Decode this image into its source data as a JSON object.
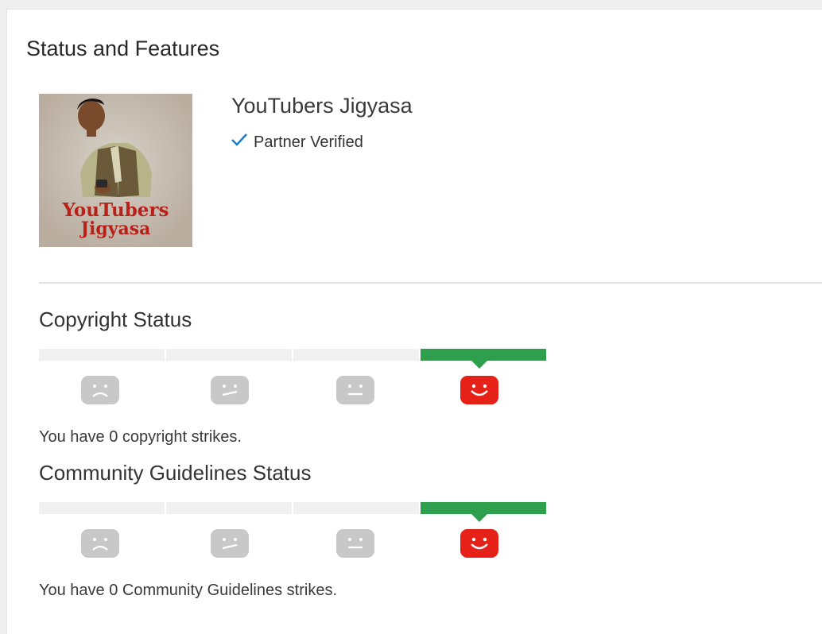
{
  "page": {
    "title": "Status and Features"
  },
  "channel": {
    "name": "YouTubers Jigyasa",
    "verified_label": "Partner Verified",
    "avatar_text_line1": "YouTubers",
    "avatar_text_line2": "Jigyasa"
  },
  "copyright": {
    "title": "Copyright Status",
    "strikes": 0,
    "message": "You have 0 copyright strikes."
  },
  "community": {
    "title": "Community Guidelines Status",
    "strikes": 0,
    "message": "You have 0 Community Guidelines strikes."
  },
  "meter_levels": [
    {
      "face": "sad-face-icon",
      "active": false
    },
    {
      "face": "skeptical-face-icon",
      "active": false
    },
    {
      "face": "neutral-face-icon",
      "active": false
    },
    {
      "face": "happy-face-icon",
      "active": true
    }
  ],
  "colors": {
    "active_bar": "#2e9f4d",
    "inactive_bar": "#f1f1f1",
    "happy_face": "#e62117",
    "inactive_face": "#c8c8c8",
    "check": "#167ac6"
  }
}
